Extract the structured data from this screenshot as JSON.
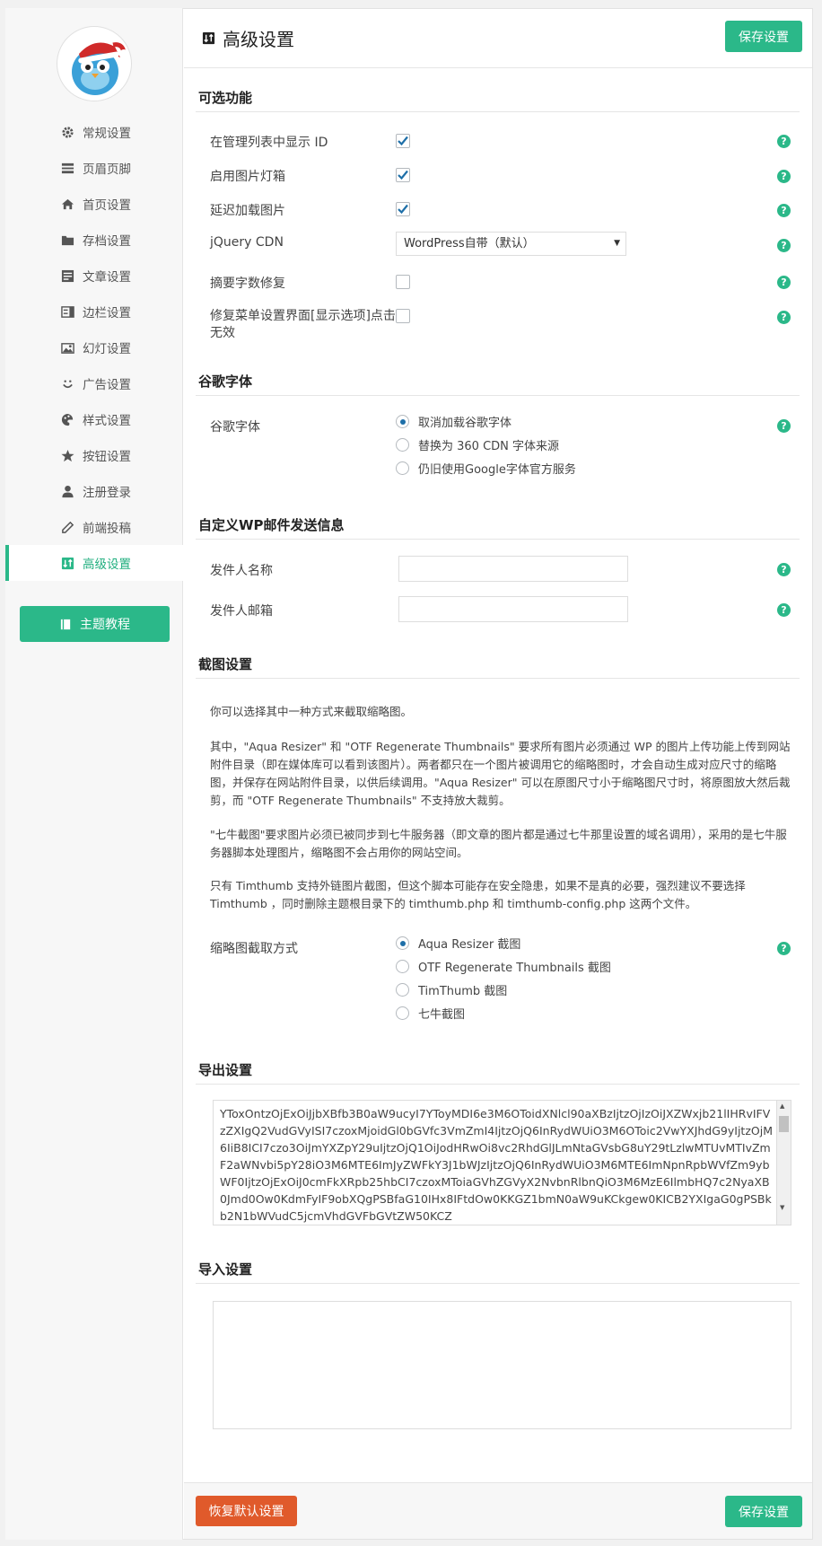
{
  "colors": {
    "accent": "#2bb889",
    "danger": "#e05a2b",
    "radio_dot": "#1e6fa8"
  },
  "sidebar": {
    "items": [
      {
        "label": "常规设置",
        "icon": "gear-icon"
      },
      {
        "label": "页眉页脚",
        "icon": "header-footer-icon"
      },
      {
        "label": "首页设置",
        "icon": "home-icon"
      },
      {
        "label": "存档设置",
        "icon": "folder-icon"
      },
      {
        "label": "文章设置",
        "icon": "article-icon"
      },
      {
        "label": "边栏设置",
        "icon": "sidebar-icon"
      },
      {
        "label": "幻灯设置",
        "icon": "slides-icon"
      },
      {
        "label": "广告设置",
        "icon": "smile-icon"
      },
      {
        "label": "样式设置",
        "icon": "palette-icon"
      },
      {
        "label": "按钮设置",
        "icon": "star-icon"
      },
      {
        "label": "注册登录",
        "icon": "user-icon"
      },
      {
        "label": "前端投稿",
        "icon": "pencil-icon"
      },
      {
        "label": "高级设置",
        "icon": "sort-icon",
        "active": true
      }
    ],
    "tutorial_label": "主题教程"
  },
  "header": {
    "title": "高级设置",
    "save_label": "保存设置"
  },
  "optional": {
    "title": "可选功能",
    "show_id_label": "在管理列表中显示 ID",
    "show_id_checked": true,
    "lightbox_label": "启用图片灯箱",
    "lightbox_checked": true,
    "lazyload_label": "延迟加载图片",
    "lazyload_checked": true,
    "jquery_label": "jQuery CDN",
    "jquery_value": "WordPress自带（默认）",
    "excerpt_label": "摘要字数修复",
    "excerpt_checked": false,
    "menu_fix_label": "修复菜单设置界面[显示选项]点击无效",
    "menu_fix_checked": false
  },
  "google_fonts": {
    "title": "谷歌字体",
    "label": "谷歌字体",
    "options": [
      "取消加载谷歌字体",
      "替换为 360 CDN 字体来源",
      "仍旧使用Google字体官方服务"
    ],
    "selected": 0
  },
  "mail": {
    "title": "自定义WP邮件发送信息",
    "sender_name_label": "发件人名称",
    "sender_name_value": "",
    "sender_email_label": "发件人邮箱",
    "sender_email_value": ""
  },
  "thumbnail": {
    "title": "截图设置",
    "para1": "你可以选择其中一种方式来截取缩略图。",
    "para2": "其中，\"Aqua Resizer\" 和 \"OTF Regenerate Thumbnails\" 要求所有图片必须通过 WP 的图片上传功能上传到网站附件目录（即在媒体库可以看到该图片）。两者都只在一个图片被调用它的缩略图时，才会自动生成对应尺寸的缩略图，并保存在网站附件目录，以供后续调用。\"Aqua Resizer\" 可以在原图尺寸小于缩略图尺寸时，将原图放大然后裁剪，而 \"OTF Regenerate Thumbnails\" 不支持放大裁剪。",
    "para3": "\"七牛截图\"要求图片必须已被同步到七牛服务器（即文章的图片都是通过七牛那里设置的域名调用），采用的是七牛服务器脚本处理图片，缩略图不会占用你的网站空间。",
    "para4": "只有 Timthumb 支持外链图片截图，但这个脚本可能存在安全隐患，如果不是真的必要，强烈建议不要选择 Timthumb ，同时删除主题根目录下的 timthumb.php 和 timthumb-config.php 这两个文件。",
    "method_label": "缩略图截取方式",
    "options": [
      "Aqua Resizer 截图",
      "OTF Regenerate Thumbnails 截图",
      "TimThumb 截图",
      "七牛截图"
    ],
    "selected": 0
  },
  "export": {
    "title": "导出设置",
    "value": "YToxOntzOjExOiJjbXBfb3B0aW9ucyI7YToyMDI6e3M6OToidXNlcl90aXBzIjtzOjIzOiJXZWxjb21lIHRvIFVzZXIgQ2VudGVyISI7czoxMjoidGl0bGVfc3VmZmI4IjtzOjQ6InRydWUiO3M6OToic2VwYXJhdG9yIjtzOjM6IiB8ICI7czo3OiJmYXZpY29uIjtzOjQ1OiJodHRwOi8vc2RhdGlJLmNtaGVsbG8uY29tLzlwMTUvMTIvZmF2aWNvbi5pY28iO3M6MTE6ImJyZWFkY3J1bWJzIjtzOjQ6InRydWUiO3M6MTE6ImNpnRpbWVfZm9ybWF0IjtzOjExOiJ0cmFkXRpb25hbCI7czoxMToiaGVhZGVyX2NvbnRlbnQiO3M6MzE6IlmbHQ7c2NyaXB0Jmd0Ow0KdmFyIF9obXQgPSBfaG10IHx8IFtdOw0KKGZ1bmN0aW9uKCkgew0KICB2YXIgaG0gPSBkb2N1bWVudC5jcmVhdGVFbGVtZW50KCZ"
  },
  "import": {
    "title": "导入设置",
    "value": ""
  },
  "footer": {
    "reset_label": "恢复默认设置",
    "save_label": "保存设置"
  }
}
